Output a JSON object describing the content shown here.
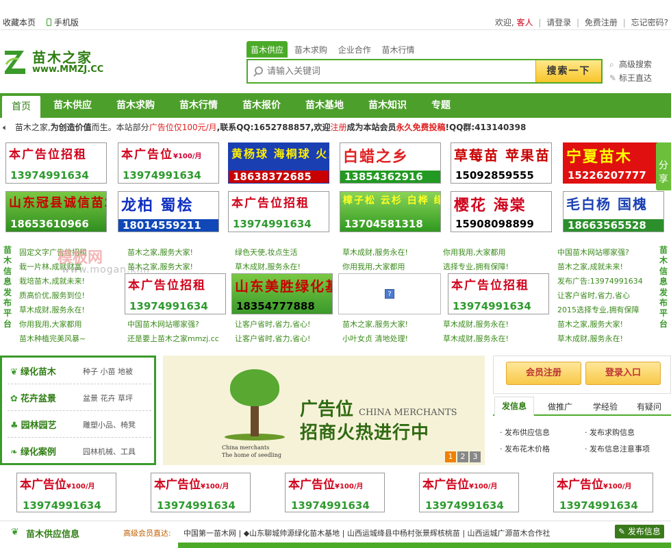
{
  "topbar": {
    "favorite": "收藏本页",
    "mobile": "手机版",
    "welcome": "欢迎,",
    "guest": "客人",
    "login": "请登录",
    "register": "免费注册",
    "forgot": "忘记密码?"
  },
  "logo": {
    "cn": "苗木之家",
    "en": "www.MMZJ.CC"
  },
  "search": {
    "tabs": [
      "苗木供应",
      "苗木求购",
      "企业合作",
      "苗木行情"
    ],
    "placeholder": "请输入关键词",
    "button": "搜索一下",
    "advanced": "高级搜索",
    "direct": "标王直达"
  },
  "nav": [
    "首页",
    "苗木供应",
    "苗木求购",
    "苗木行情",
    "苗木报价",
    "苗木基地",
    "苗木知识",
    "专题"
  ],
  "notice": {
    "p1": "苗木之家,",
    "p2": "为创造价值",
    "p3": "而生。本站部分",
    "p4": "广告位仅100元/月",
    "p5": ",联系QQ:1652788857,欢迎",
    "p6": "注册",
    "p7": "成为本站会员",
    "p8": "永久免费投稿",
    "p9": "!QQ群:413140398"
  },
  "ads_row1": [
    {
      "t": "本广告位招租",
      "p": "13974991634",
      "s": ""
    },
    {
      "t": "本广告位",
      "m": "¥100/月",
      "p": "13974991634",
      "s": ""
    },
    {
      "t": "黄杨球 海桐球 火棘球",
      "p": "18638372685",
      "s": "c1"
    },
    {
      "t": "白蜡之乡",
      "p": "13854362916",
      "s": "c2"
    },
    {
      "t": "草莓苗 苹果苗",
      "p": "15092859555",
      "s": "c3"
    },
    {
      "t": "宁夏苗木",
      "p": "15226207777",
      "s": "c4"
    }
  ],
  "ads_row2": [
    {
      "t": "山东冠县诚信苗木",
      "p": "18653610966",
      "s": "c5"
    },
    {
      "t": "龙柏 蜀桧",
      "p": "18014559211",
      "s": "c6"
    },
    {
      "t": "本广告位招租",
      "p": "13974991634",
      "s": ""
    },
    {
      "t": "樟子松 云杉 白桦 绿化树",
      "p": "13704581318",
      "s": "c7"
    },
    {
      "t": "樱花 海棠",
      "p": "15908098899",
      "s": "c8"
    },
    {
      "t": "毛白杨 国槐",
      "p": "18663565528",
      "s": "c9"
    }
  ],
  "side_text": "苗木信息发布平台",
  "text_cols": [
    [
      "固定文字广告位招租",
      "栽一片林,成就财富",
      "栽培苗木,成就未来!",
      "质高价优,服务到位!",
      "草木成财,服务永在!",
      "你用我用,大家都用",
      "苗木种植完美风暴~"
    ],
    [
      "苗木之家,服务大家!",
      "苗木之家,服务大家!",
      "",
      "",
      "",
      "中国苗木网站哪家强?",
      "还是要上苗木之家mmzj.cc"
    ],
    [
      "绿色天使,妆点生活",
      "草木成财,服务永在!",
      "",
      "",
      "",
      "让客户省时,省力,省心!",
      "让客户省时,省力,省心!"
    ],
    [
      "草木成财,服务永在!",
      "你用我用,大家都用",
      "",
      "",
      "",
      "苗木之家,服务大家!",
      "小叶女贞 清地处理!"
    ],
    [
      "你用我用,大家都用",
      "选择专业,拥有保障!",
      "",
      "",
      "",
      "草木成财,服务永在!",
      "草木成财,服务永在!"
    ],
    [
      "中国苗木网站哪家强?",
      "苗木之家,成就未来!",
      "发布广告:13974991634",
      "让客户省时,省力,省心",
      "2015选择专业,拥有保障",
      "苗木之家,服务大家!",
      "草木成财,服务永在!"
    ]
  ],
  "mid_ads": [
    {
      "t": "本广告位招租",
      "p": "13974991634",
      "s": ""
    },
    {
      "t": "山东美胜绿化基地",
      "p": "18354777888",
      "s": "c10"
    },
    {
      "t": "本广告位招租",
      "p": "13974991634",
      "s": ""
    }
  ],
  "watermark": {
    "t": "模板网",
    "u": "www.mogan.kim"
  },
  "categories": [
    {
      "name": "绿化苗木",
      "subs": "种子  小苗  地被"
    },
    {
      "name": "花卉盆景",
      "subs": "盆景  花卉  草坪"
    },
    {
      "name": "园林园艺",
      "subs": "雕塑小品、椅凳"
    },
    {
      "name": "绿化案例",
      "subs": "园林机械、工具"
    }
  ],
  "banner": {
    "cap1": "China merchants",
    "cap2": "The home of seedling",
    "t1": "广告位",
    "t1en": "CHINA MERCHANTS",
    "t2": "招商火热进行中",
    "pages": [
      "1",
      "2",
      "3"
    ]
  },
  "member": {
    "register": "会员注册",
    "login": "登录入口",
    "tabs": [
      "发信息",
      "做推广",
      "学经验",
      "有疑问"
    ],
    "links": [
      "· 发布供应信息",
      "· 发布求购信息",
      "· 发布花木价格",
      "· 发布信息注意事项"
    ]
  },
  "bottom_ads": [
    {
      "t": "本广告位",
      "m": "¥100/月",
      "p": "13974991634"
    },
    {
      "t": "本广告位",
      "m": "¥100/月",
      "p": "13974991634"
    },
    {
      "t": "本广告位",
      "m": "¥100/月",
      "p": "13974991634"
    },
    {
      "t": "本广告位",
      "m": "¥100/月",
      "p": "13974991634"
    },
    {
      "t": "本广告位",
      "m": "¥100/月",
      "p": "13974991634"
    }
  ],
  "supply": {
    "title": "苗木供应信息",
    "label": "高级会员直达:",
    "links": "中国第一苗木网 | ◆山东聊城帅源绿化苗木基地 | 山西运城绛县中杨村张景辉核桃苗 | 山西运城广源苗木合作社",
    "publish": "发布信息"
  },
  "share": "分享"
}
